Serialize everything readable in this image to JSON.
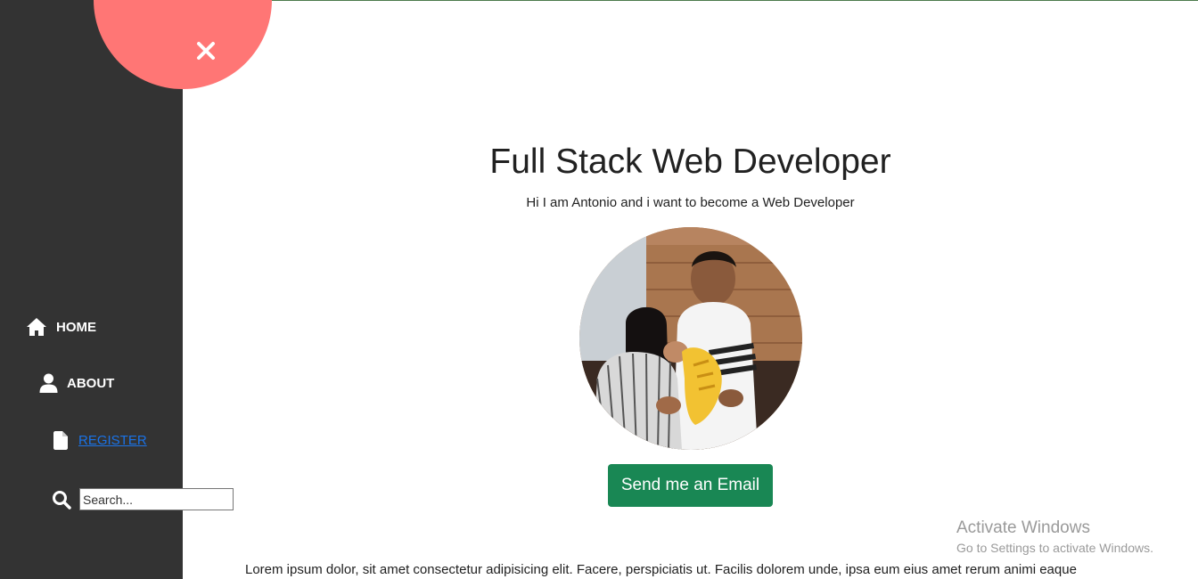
{
  "sidebar": {
    "close_icon": "close-icon",
    "items": [
      {
        "label": "HOME",
        "icon": "home-icon"
      },
      {
        "label": "ABOUT",
        "icon": "user-icon"
      },
      {
        "label": "REGISTER",
        "icon": "file-icon"
      }
    ],
    "search": {
      "placeholder": "Search...",
      "icon": "search-icon"
    }
  },
  "main": {
    "title": "Full Stack Web Developer",
    "subtitle": "Hi I am Antonio and i want to become a Web Developer",
    "email_button": "Send me an Email",
    "paragraph": "Lorem ipsum dolor, sit amet consectetur adipisicing elit. Facere, perspiciatis ut. Facilis dolorem unde, ipsa eum eius amet rerum animi eaque"
  },
  "watermark": {
    "line1": "Activate Windows",
    "line2": "Go to Settings to activate Windows."
  },
  "colors": {
    "sidebar_bg": "#333333",
    "close_circle": "#ff7675",
    "button_green": "#198754",
    "link_blue": "#1a73e8"
  }
}
